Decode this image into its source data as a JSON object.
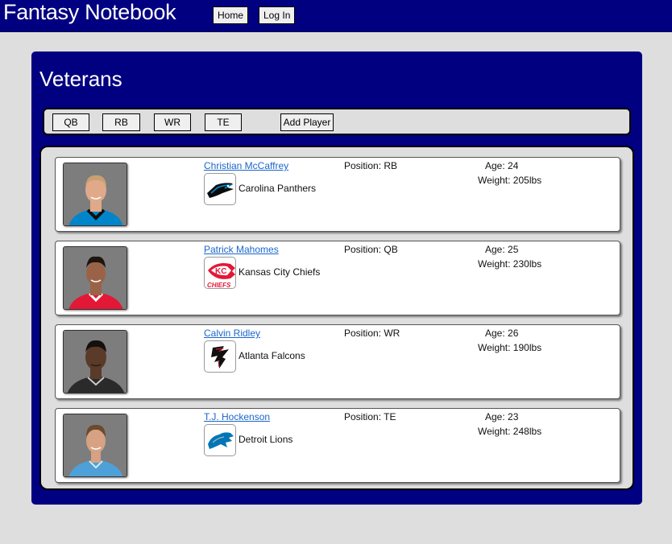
{
  "header": {
    "app_title": "Fantasy Notebook",
    "nav": [
      {
        "label": "Home"
      },
      {
        "label": "Log In"
      }
    ]
  },
  "main": {
    "title": "Veterans",
    "filters": [
      {
        "label": "QB"
      },
      {
        "label": "RB"
      },
      {
        "label": "WR"
      },
      {
        "label": "TE"
      }
    ],
    "add_player_label": "Add Player",
    "players": [
      {
        "name": "Christian McCaffrey",
        "team": "Carolina Panthers",
        "position": "Position: RB",
        "age": "Age: 24",
        "weight": "Weight: 205lbs",
        "jersey_color": "#0085ca",
        "skin": "#e0a98a",
        "hair": "#c9a070"
      },
      {
        "name": "Patrick Mahomes",
        "team": "Kansas City Chiefs",
        "position": "Position: QB",
        "age": "Age: 25",
        "weight": "Weight: 230lbs",
        "jersey_color": "#e31837",
        "skin": "#9a6347",
        "hair": "#1e1410"
      },
      {
        "name": "Calvin Ridley",
        "team": "Atlanta Falcons",
        "position": "Position: WR",
        "age": "Age: 26",
        "weight": "Weight: 190lbs",
        "jersey_color": "#2a2a2a",
        "skin": "#5a3a28",
        "hair": "#151010"
      },
      {
        "name": "T.J. Hockenson",
        "team": "Detroit Lions",
        "position": "Position: TE",
        "age": "Age: 23",
        "weight": "Weight: 248lbs",
        "jersey_color": "#4da0d8",
        "skin": "#d6a283",
        "hair": "#6b4a2e"
      }
    ]
  },
  "colors": {
    "brand_navy": "#000080",
    "link_blue": "#1a66cc",
    "page_bg": "#dedede"
  },
  "icons": {
    "team_logos": [
      "panthers-logo-icon",
      "chiefs-logo-icon",
      "falcons-logo-icon",
      "lions-logo-icon"
    ]
  }
}
